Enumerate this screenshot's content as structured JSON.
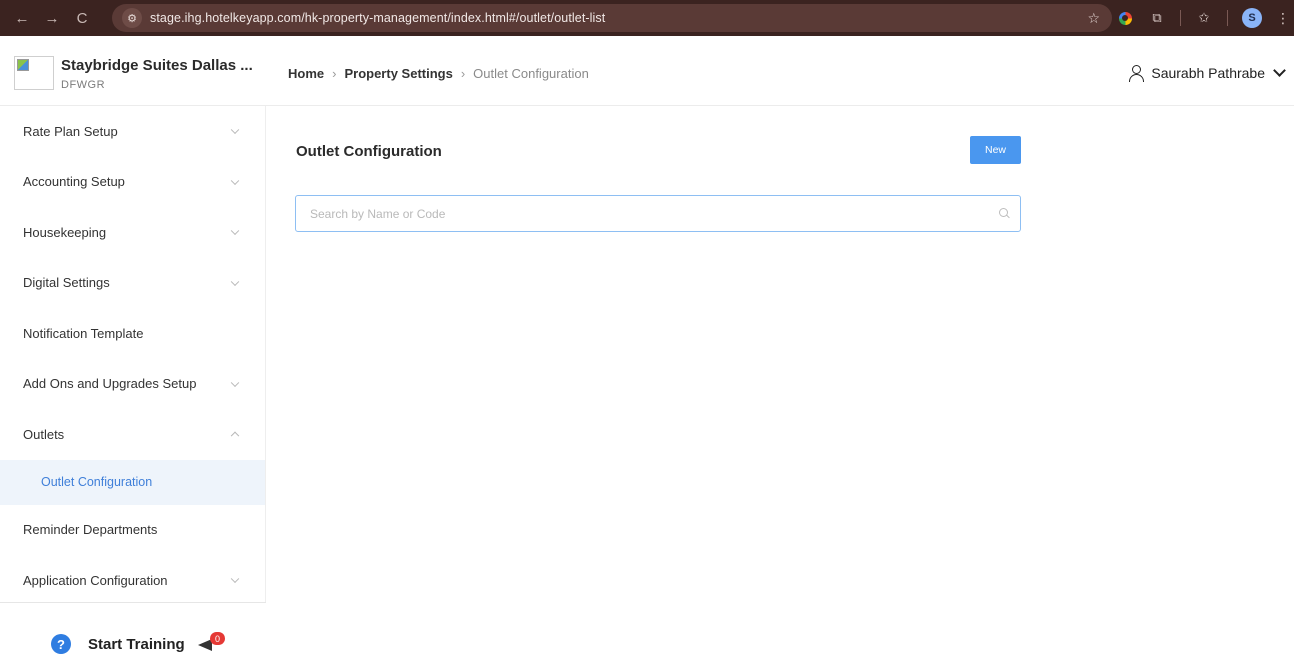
{
  "browser": {
    "back_icon": "←",
    "forward_icon": "→",
    "reload_icon": "C",
    "url": "stage.ihg.hotelkeyapp.com/hk-property-management/index.html#/outlet/outlet-list",
    "profile_initial": "S"
  },
  "header": {
    "hotel_name": "Staybridge Suites Dallas ...",
    "hotel_code": "DFWGR",
    "breadcrumb": {
      "home": "Home",
      "property_settings": "Property Settings",
      "current": "Outlet Configuration"
    },
    "user_name": "Saurabh Pathrabe"
  },
  "sidebar": {
    "items": [
      {
        "label": "Rate Plan Setup"
      },
      {
        "label": "Accounting Setup"
      },
      {
        "label": "Housekeeping"
      },
      {
        "label": "Digital Settings"
      },
      {
        "label": "Notification Template"
      },
      {
        "label": "Add Ons and Upgrades Setup"
      },
      {
        "label": "Outlets"
      },
      {
        "label": "Reminder Departments"
      },
      {
        "label": "Application Configuration"
      }
    ],
    "sub_item": "Outlet Configuration",
    "training_label": "Start Training",
    "training_badge": "0"
  },
  "main": {
    "title": "Outlet Configuration",
    "new_button": "New",
    "search_placeholder": "Search by Name or Code"
  },
  "colors": {
    "accent": "#4a97ef",
    "active_bg": "#eef4fb",
    "active_text": "#3f7fd9",
    "browser_bg": "#3b2320"
  }
}
